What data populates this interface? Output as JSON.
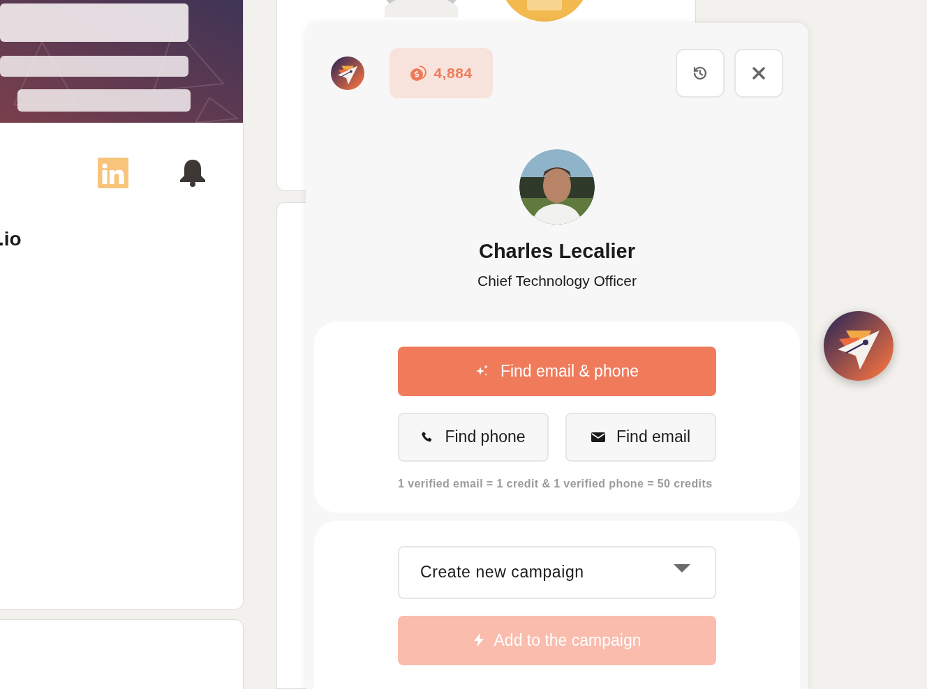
{
  "background_page": {
    "profile_domain": ".io"
  },
  "panel": {
    "credits": "4,884",
    "profile": {
      "name": "Charles Lecalier",
      "job_title": "Chief Technology Officer"
    },
    "find_actions": {
      "primary": {
        "label": "Find email & phone"
      },
      "secondary": [
        {
          "kind": "phone",
          "label": "Find phone"
        },
        {
          "kind": "email",
          "label": "Find email"
        }
      ],
      "note": "1 verified email = 1 credit & 1 verified phone = 50 credits"
    },
    "campaign": {
      "select_value": "Create new campaign",
      "add_button": {
        "label": "Add to the campaign",
        "disabled": true
      }
    }
  }
}
